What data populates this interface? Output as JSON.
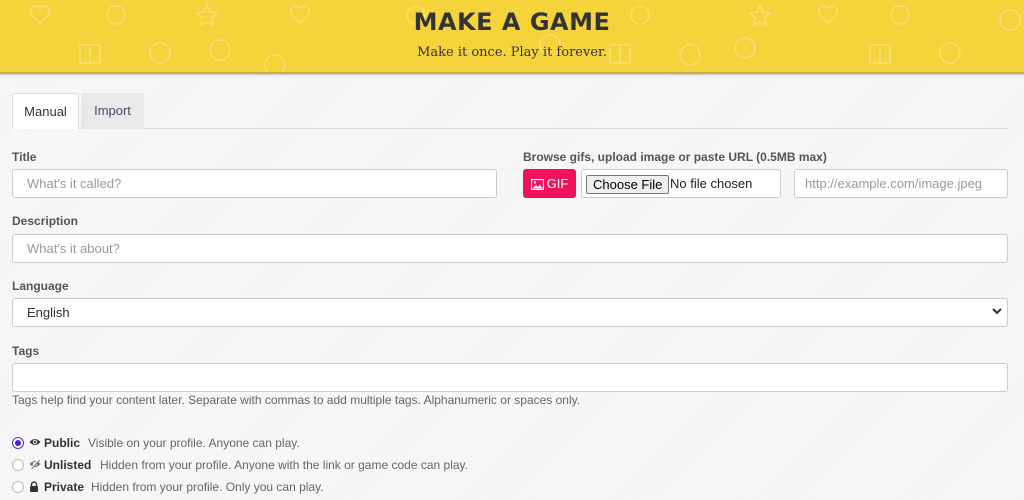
{
  "header": {
    "title": "Make a Game",
    "tagline": "Make it once. Play it forever."
  },
  "tabs": [
    {
      "label": "Manual",
      "active": true
    },
    {
      "label": "Import",
      "active": false
    }
  ],
  "form": {
    "title": {
      "label": "Title",
      "placeholder": "What's it called?",
      "value": ""
    },
    "image": {
      "label": "Browse gifs, upload image or paste URL (0.5MB max)",
      "gif_button": "GIF",
      "choose_file_button": "Choose File",
      "file_status": "No file chosen",
      "url_placeholder": "http://example.com/image.jpeg"
    },
    "description": {
      "label": "Description",
      "placeholder": "What's it about?",
      "value": ""
    },
    "language": {
      "label": "Language",
      "selected": "English"
    },
    "tags": {
      "label": "Tags",
      "value": "",
      "help": "Tags help find your content later. Separate with commas to add multiple tags. Alphanumeric or spaces only."
    },
    "visibility": [
      {
        "name": "Public",
        "description": "Visible on your profile. Anyone can play.",
        "checked": true,
        "icon": "eye-icon"
      },
      {
        "name": "Unlisted",
        "description": "Hidden from your profile. Anyone with the link or game code can play.",
        "checked": false,
        "icon": "eye-slash-icon"
      },
      {
        "name": "Private",
        "description": "Hidden from your profile. Only you can play.",
        "checked": false,
        "icon": "lock-icon"
      }
    ]
  },
  "colors": {
    "banner": "#f5d33a",
    "gif_button": "#f0125d",
    "radio_checked": "#4b1ee0"
  }
}
